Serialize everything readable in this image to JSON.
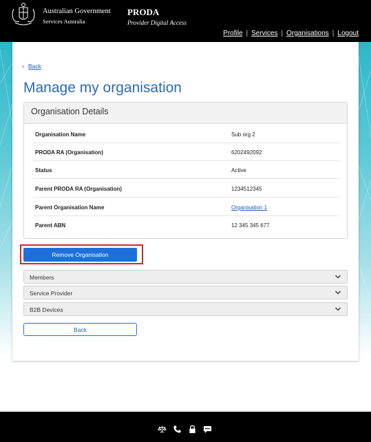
{
  "header": {
    "gov_line1": "Australian Government",
    "gov_line2": "Services Australia",
    "app_title": "PRODA",
    "app_subtitle": "Provider Digital Access",
    "nav": [
      {
        "label": "Profile"
      },
      {
        "label": "Services"
      },
      {
        "label": "Organisations"
      },
      {
        "label": "Logout"
      }
    ]
  },
  "main": {
    "back_link": "Back",
    "page_title": "Manage my organisation",
    "details": {
      "heading": "Organisation Details",
      "rows": [
        {
          "key": "Organisation Name",
          "value": "Sub org 2"
        },
        {
          "key": "PRODA RA (Organisation)",
          "value": "6202492092"
        },
        {
          "key": "Status",
          "value": "Active"
        },
        {
          "key": "Parent PRODA RA (Organisation)",
          "value": "1234512345"
        },
        {
          "key": "Parent Organisation Name",
          "value": "Organisation 1"
        },
        {
          "key": "Parent ABN",
          "value": "12 345 345 677"
        }
      ]
    },
    "remove_button": "Remove Organisation",
    "accordions": [
      {
        "label": "Members"
      },
      {
        "label": "Service Provider"
      },
      {
        "label": "B2B Devices"
      }
    ],
    "back_button": "Back"
  },
  "footer": {
    "icons": [
      "accessibility-scales-icon",
      "phone-icon",
      "lock-icon",
      "chat-icon"
    ]
  },
  "colors": {
    "header_bg": "#000000",
    "title_blue": "#2a6ab5",
    "primary_button": "#1e6fd9",
    "highlight_red": "#d9252a",
    "link_blue": "#1a5fb4"
  }
}
